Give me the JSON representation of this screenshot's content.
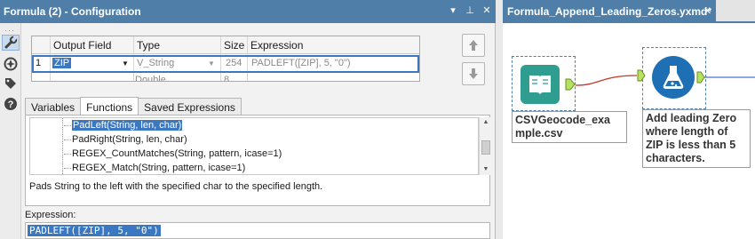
{
  "config_panel": {
    "title": "Formula (2) - Configuration",
    "title_buttons": [
      "▾",
      "⊥",
      "✕"
    ],
    "side_tools": [
      "wrench-icon",
      "compass-icon",
      "tag-icon",
      "help-icon"
    ],
    "grid": {
      "columns": [
        "Output Field",
        "Type",
        "Size",
        "Expression"
      ],
      "rows": [
        {
          "num": "1",
          "field": "ZIP",
          "type": "V_String",
          "size": "254",
          "expression": "PADLEFT([ZIP], 5, \"0\")"
        },
        {
          "num": "",
          "field": "",
          "type": "Double",
          "size": "8",
          "expression": ""
        }
      ]
    },
    "tabs": [
      "Variables",
      "Functions",
      "Saved Expressions"
    ],
    "active_tab": "Functions",
    "functions": [
      {
        "label": "PadLeft(String, len, char)",
        "selected": true
      },
      {
        "label": "PadRight(String, len, char)",
        "selected": false
      },
      {
        "label": "REGEX_CountMatches(String, pattern, icase=1)",
        "selected": false
      },
      {
        "label": "REGEX_Match(String, pattern, icase=1)",
        "selected": false
      }
    ],
    "function_description": "Pads String to the left with the specified char to the specified length.",
    "expression_label": "Expression:",
    "expression_value": "PADLEFT([ZIP], 5, \"0\")"
  },
  "canvas": {
    "tab_label": "Formula_Append_Leading_Zeros.yxmd*",
    "tab_close": "✕",
    "input_node": {
      "label_line1": "CSVGeocode_exa",
      "label_line2": "mple.csv",
      "icon": "book-icon",
      "color": "#2f9d8f"
    },
    "formula_node": {
      "label_lines": [
        "Add leading Zero",
        "where length of",
        "ZIP is less than 5",
        "characters."
      ],
      "icon": "flask-icon",
      "color": "#1f6fb5"
    },
    "connection_color": "#c0392b",
    "output_connection_color": "#4a6fd8"
  }
}
